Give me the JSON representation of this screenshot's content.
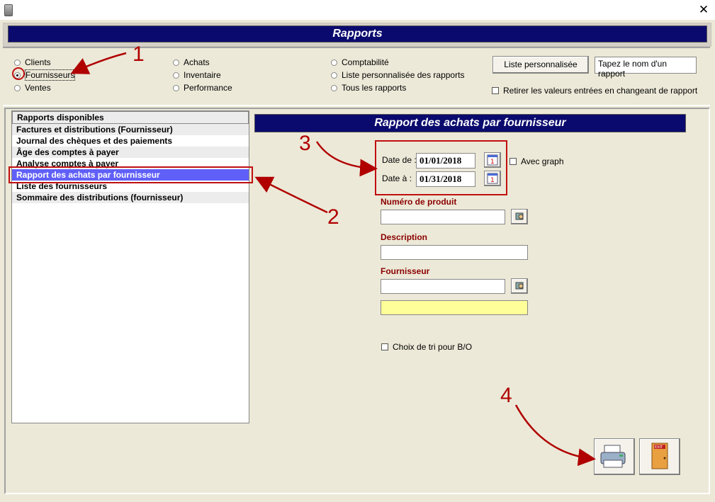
{
  "window": {
    "close_symbol": "✕"
  },
  "header": {
    "title": "Rapports"
  },
  "categories": {
    "col1": [
      {
        "label": "Clients",
        "selected": false
      },
      {
        "label": "Fournisseurs",
        "selected": true
      },
      {
        "label": "Ventes",
        "selected": false
      }
    ],
    "col2": [
      {
        "label": "Achats",
        "selected": false
      },
      {
        "label": "Inventaire",
        "selected": false
      },
      {
        "label": "Performance",
        "selected": false
      }
    ],
    "col3": [
      {
        "label": "Comptabilité",
        "selected": false
      },
      {
        "label": "Liste personnalisée des rapports",
        "selected": false
      },
      {
        "label": "Tous les rapports",
        "selected": false
      }
    ]
  },
  "custom_list": {
    "button_label": "Liste personnalisée",
    "search_value": "Tapez le nom d'un rapport"
  },
  "retain_values": {
    "label": "Retirer les valeurs entrées en changeant de rapport",
    "checked": false
  },
  "reports": {
    "header": "Rapports disponibles",
    "items": [
      "Factures et distributions (Fournisseur)",
      "Journal des chèques et des paiements",
      "Âge des comptes à payer",
      "Analyse comptes à payer",
      "Rapport des achats par fournisseur",
      "Liste des fournisseurs",
      "Sommaire des distributions (fournisseur)"
    ],
    "selected_index": 4
  },
  "report_panel": {
    "title": "Rapport des achats par fournisseur",
    "date_from_label": "Date de :",
    "date_from": "01/01/2018",
    "date_to_label": "Date à :",
    "date_to": "01/31/2018",
    "graph_label": "Avec graph",
    "product_label": "Numéro de produit",
    "product_value": "",
    "description_label": "Description",
    "description_value": "",
    "supplier_label": "Fournisseur",
    "supplier_value": "",
    "supplier_name": "",
    "sort_label": "Choix de tri pour B/O"
  },
  "annotations": {
    "n1": "1",
    "n2": "2",
    "n3": "3",
    "n4": "4",
    "color": "#b00000"
  },
  "icons": {
    "print": "printer-icon",
    "exit": "exit-door-icon",
    "calendar": "calendar-icon",
    "lookup": "lookup-icon"
  }
}
